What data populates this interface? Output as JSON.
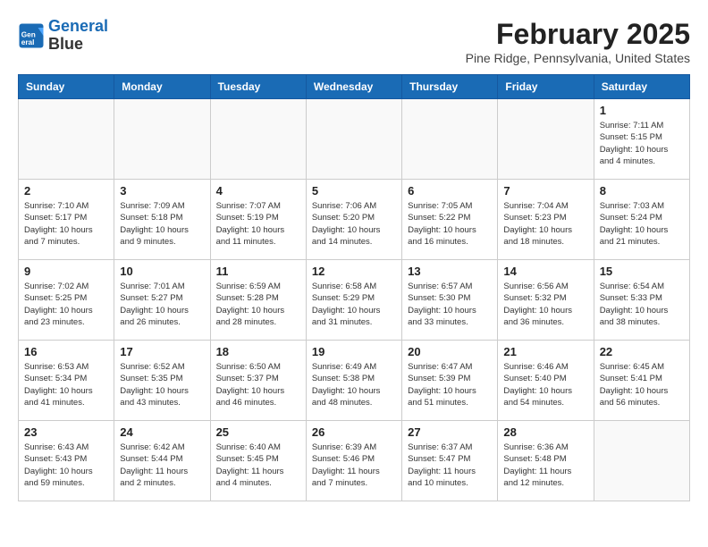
{
  "header": {
    "logo_line1": "General",
    "logo_line2": "Blue",
    "month": "February 2025",
    "location": "Pine Ridge, Pennsylvania, United States"
  },
  "days_of_week": [
    "Sunday",
    "Monday",
    "Tuesday",
    "Wednesday",
    "Thursday",
    "Friday",
    "Saturday"
  ],
  "weeks": [
    [
      {
        "day": "",
        "detail": ""
      },
      {
        "day": "",
        "detail": ""
      },
      {
        "day": "",
        "detail": ""
      },
      {
        "day": "",
        "detail": ""
      },
      {
        "day": "",
        "detail": ""
      },
      {
        "day": "",
        "detail": ""
      },
      {
        "day": "1",
        "detail": "Sunrise: 7:11 AM\nSunset: 5:15 PM\nDaylight: 10 hours and 4 minutes."
      }
    ],
    [
      {
        "day": "2",
        "detail": "Sunrise: 7:10 AM\nSunset: 5:17 PM\nDaylight: 10 hours and 7 minutes."
      },
      {
        "day": "3",
        "detail": "Sunrise: 7:09 AM\nSunset: 5:18 PM\nDaylight: 10 hours and 9 minutes."
      },
      {
        "day": "4",
        "detail": "Sunrise: 7:07 AM\nSunset: 5:19 PM\nDaylight: 10 hours and 11 minutes."
      },
      {
        "day": "5",
        "detail": "Sunrise: 7:06 AM\nSunset: 5:20 PM\nDaylight: 10 hours and 14 minutes."
      },
      {
        "day": "6",
        "detail": "Sunrise: 7:05 AM\nSunset: 5:22 PM\nDaylight: 10 hours and 16 minutes."
      },
      {
        "day": "7",
        "detail": "Sunrise: 7:04 AM\nSunset: 5:23 PM\nDaylight: 10 hours and 18 minutes."
      },
      {
        "day": "8",
        "detail": "Sunrise: 7:03 AM\nSunset: 5:24 PM\nDaylight: 10 hours and 21 minutes."
      }
    ],
    [
      {
        "day": "9",
        "detail": "Sunrise: 7:02 AM\nSunset: 5:25 PM\nDaylight: 10 hours and 23 minutes."
      },
      {
        "day": "10",
        "detail": "Sunrise: 7:01 AM\nSunset: 5:27 PM\nDaylight: 10 hours and 26 minutes."
      },
      {
        "day": "11",
        "detail": "Sunrise: 6:59 AM\nSunset: 5:28 PM\nDaylight: 10 hours and 28 minutes."
      },
      {
        "day": "12",
        "detail": "Sunrise: 6:58 AM\nSunset: 5:29 PM\nDaylight: 10 hours and 31 minutes."
      },
      {
        "day": "13",
        "detail": "Sunrise: 6:57 AM\nSunset: 5:30 PM\nDaylight: 10 hours and 33 minutes."
      },
      {
        "day": "14",
        "detail": "Sunrise: 6:56 AM\nSunset: 5:32 PM\nDaylight: 10 hours and 36 minutes."
      },
      {
        "day": "15",
        "detail": "Sunrise: 6:54 AM\nSunset: 5:33 PM\nDaylight: 10 hours and 38 minutes."
      }
    ],
    [
      {
        "day": "16",
        "detail": "Sunrise: 6:53 AM\nSunset: 5:34 PM\nDaylight: 10 hours and 41 minutes."
      },
      {
        "day": "17",
        "detail": "Sunrise: 6:52 AM\nSunset: 5:35 PM\nDaylight: 10 hours and 43 minutes."
      },
      {
        "day": "18",
        "detail": "Sunrise: 6:50 AM\nSunset: 5:37 PM\nDaylight: 10 hours and 46 minutes."
      },
      {
        "day": "19",
        "detail": "Sunrise: 6:49 AM\nSunset: 5:38 PM\nDaylight: 10 hours and 48 minutes."
      },
      {
        "day": "20",
        "detail": "Sunrise: 6:47 AM\nSunset: 5:39 PM\nDaylight: 10 hours and 51 minutes."
      },
      {
        "day": "21",
        "detail": "Sunrise: 6:46 AM\nSunset: 5:40 PM\nDaylight: 10 hours and 54 minutes."
      },
      {
        "day": "22",
        "detail": "Sunrise: 6:45 AM\nSunset: 5:41 PM\nDaylight: 10 hours and 56 minutes."
      }
    ],
    [
      {
        "day": "23",
        "detail": "Sunrise: 6:43 AM\nSunset: 5:43 PM\nDaylight: 10 hours and 59 minutes."
      },
      {
        "day": "24",
        "detail": "Sunrise: 6:42 AM\nSunset: 5:44 PM\nDaylight: 11 hours and 2 minutes."
      },
      {
        "day": "25",
        "detail": "Sunrise: 6:40 AM\nSunset: 5:45 PM\nDaylight: 11 hours and 4 minutes."
      },
      {
        "day": "26",
        "detail": "Sunrise: 6:39 AM\nSunset: 5:46 PM\nDaylight: 11 hours and 7 minutes."
      },
      {
        "day": "27",
        "detail": "Sunrise: 6:37 AM\nSunset: 5:47 PM\nDaylight: 11 hours and 10 minutes."
      },
      {
        "day": "28",
        "detail": "Sunrise: 6:36 AM\nSunset: 5:48 PM\nDaylight: 11 hours and 12 minutes."
      },
      {
        "day": "",
        "detail": ""
      }
    ]
  ]
}
